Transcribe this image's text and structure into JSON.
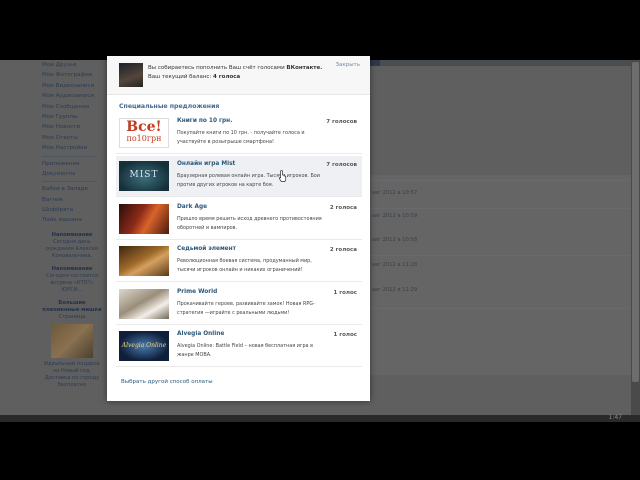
{
  "left_nav": {
    "items": [
      "Мои Друзья",
      "Мои Фотографии",
      "Мои Видеозаписи",
      "Мои Аудиозаписи",
      "Мои Сообщения",
      "Мои Группы",
      "Мои Новости",
      "Мои Ответы",
      "Мои Настройки"
    ],
    "items2": [
      "Приложения",
      "Документы"
    ],
    "items3": [
      "Бабки в Западе",
      "Ватник",
      "Шофёрята",
      "Лайк машина"
    ]
  },
  "reminders": [
    {
      "title": "Напоминание",
      "text": "Сегодня день рождения Алексея Коновальчика."
    },
    {
      "title": "Напоминание",
      "text": "Сегодня состоится встреча «КТО?» ЮРСИ..."
    }
  ],
  "ad": {
    "title": "Большие плазменные мишки",
    "sub": "Страница",
    "text": "Идеальный подарок на Новый год. Доставка по городу бесплатно"
  },
  "bg_rows": [
    "авг 2012 в 10:57",
    "авг 2012 в 10:59",
    "авг 2012 в 10:58",
    "авг 2012 в 11:28",
    "авг 2012 в 11:29"
  ],
  "modal": {
    "header_line1_prefix": "Вы собираетесь пополнить Ваш счёт голосами",
    "header_line1_brand": "ВКонтакте.",
    "header_line2_prefix": "Ваш текущий баланс:",
    "header_line2_value": "4 голоса",
    "close_label": "Закрыть",
    "section_title": "Специальные предложения",
    "footer_link": "Выбрать другой способ оплаты",
    "offers": [
      {
        "title": "Книги по 10 грн.",
        "desc": "Покупайте книги по 10 грн. - получайте голоса и участвуйте в розыгрыше смартфона!",
        "votes": "7 голосов",
        "thumb_big": "Все!",
        "thumb_small": "по10грн"
      },
      {
        "title": "Онлайн игра Mist",
        "desc": "Браузерная ролевая онлайн игра. Тысячи игроков. Бои против других игроков на карте боя.",
        "votes": "7 голосов",
        "thumb_text": "MIST"
      },
      {
        "title": "Dark Age",
        "desc": "Пришло время решить исход древнего противостояния оборотней и вампиров.",
        "votes": "2 голоса"
      },
      {
        "title": "Седьмой элемент",
        "desc": "Революционная боевая система, продуманный мир, тысячи игроков онлайн и никаких ограничений!",
        "votes": "2 голоса"
      },
      {
        "title": "Prime World",
        "desc": "Прокачивайте героев, развивайте замок! Новая RPG-стратегия —играйте с реальными людьми!",
        "votes": "1 голос"
      },
      {
        "title": "Alvegia Online",
        "desc": "Alvegia Online: Battle Field – новая бесплатная игра в жанре MOBA.",
        "votes": "1 голос",
        "thumb_text": "Alvegia Online"
      }
    ]
  },
  "bottom_text": "1:47",
  "colors": {
    "link": "#2b587a",
    "section": "#45688e",
    "overlay": "#5f5f5f"
  }
}
